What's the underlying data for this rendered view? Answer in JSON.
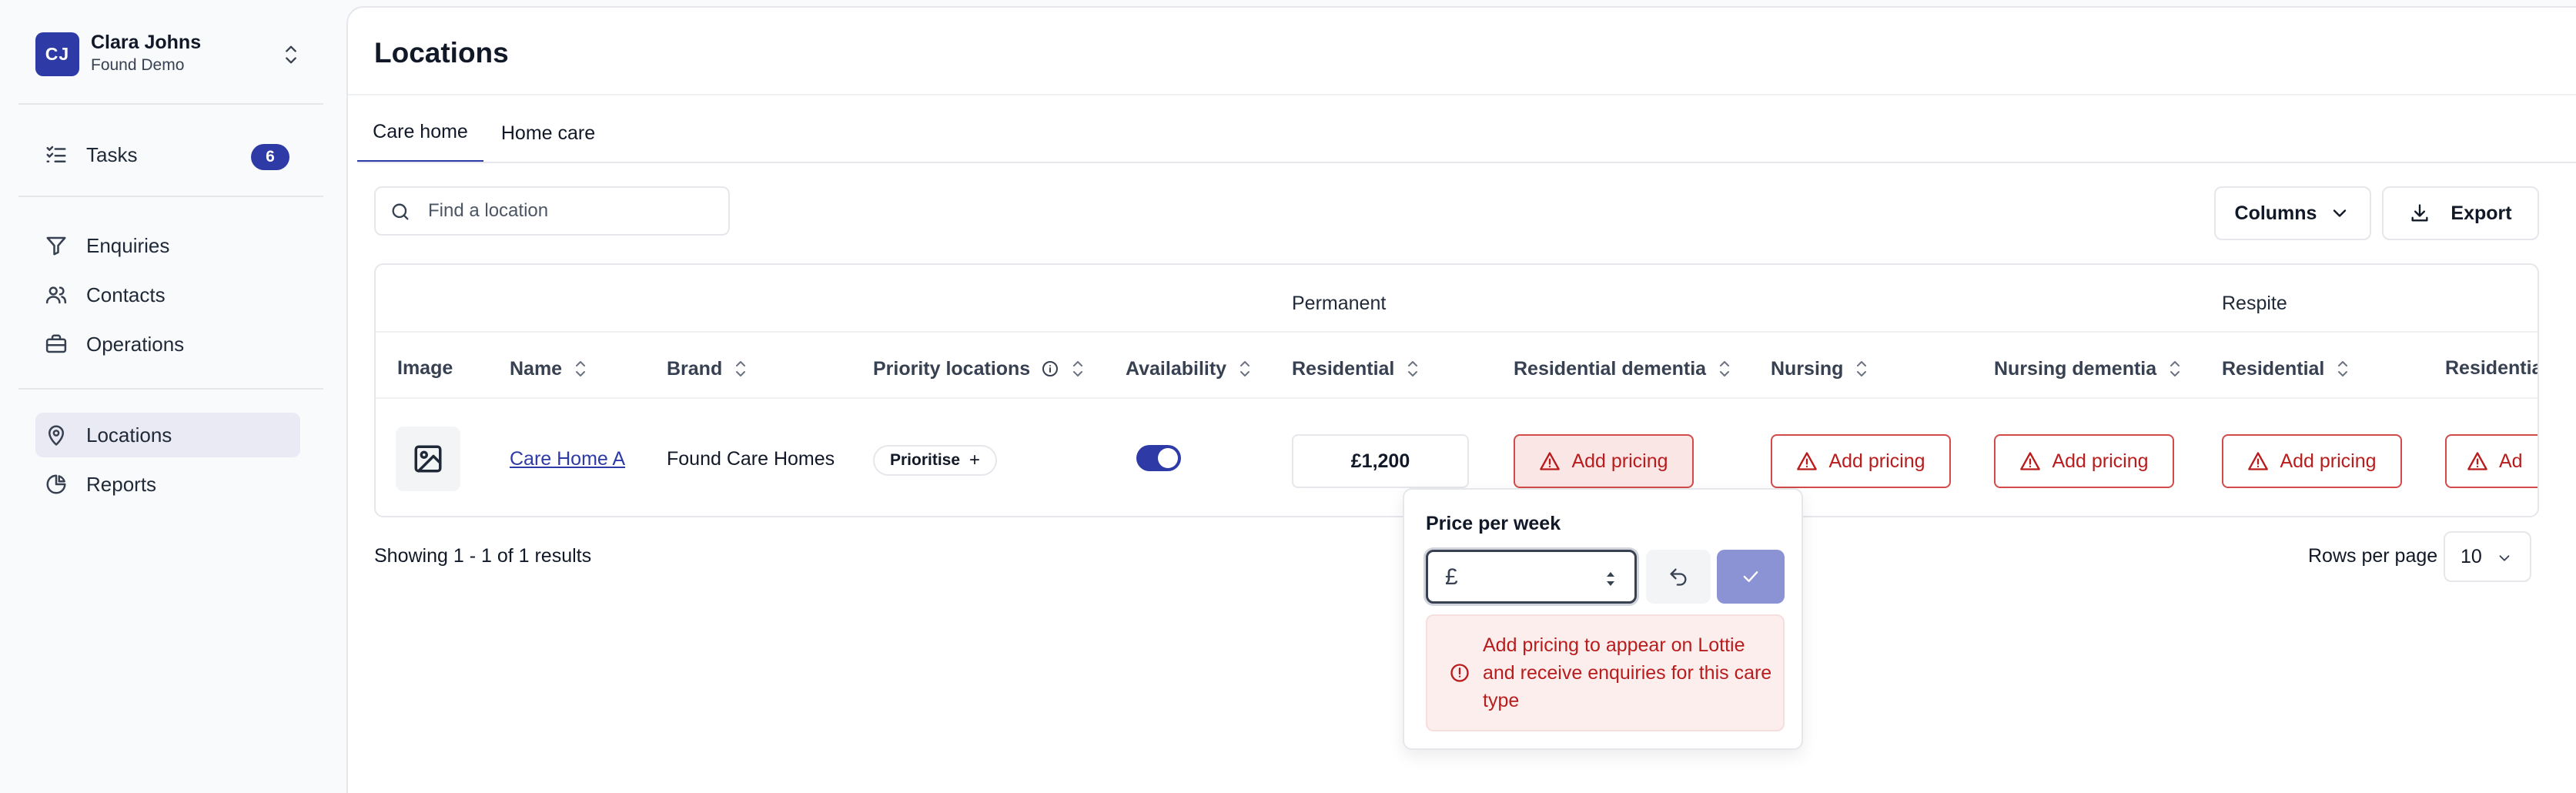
{
  "sidebar": {
    "user": {
      "initials": "CJ",
      "name": "Clara Johns",
      "org": "Found Demo"
    },
    "tasks": {
      "label": "Tasks",
      "count": "6"
    },
    "items": [
      {
        "label": "Enquiries",
        "icon": "filter-icon"
      },
      {
        "label": "Contacts",
        "icon": "users-icon"
      },
      {
        "label": "Operations",
        "icon": "briefcase-icon"
      },
      {
        "label": "Locations",
        "icon": "map-pin-icon",
        "active": true
      },
      {
        "label": "Reports",
        "icon": "pie-chart-icon"
      }
    ]
  },
  "main": {
    "title": "Locations",
    "tabs": [
      {
        "label": "Care home",
        "active": true
      },
      {
        "label": "Home care",
        "active": false
      }
    ],
    "search": {
      "placeholder": "Find a location",
      "value": ""
    },
    "toolbar": {
      "columns_label": "Columns",
      "export_label": "Export"
    },
    "table": {
      "groups": [
        "Permanent",
        "Respite"
      ],
      "columns": [
        "Image",
        "Name",
        "Brand",
        "Priority locations",
        "Availability",
        "Residential",
        "Residential dementia",
        "Nursing",
        "Nursing dementia",
        "Residential",
        "Residentia"
      ],
      "row": {
        "name": "Care Home A",
        "brand": "Found Care Homes",
        "priority_label": "Prioritise",
        "availability_on": true,
        "residential_price": "£1,200",
        "add_pricing_label": "Add pricing",
        "add_pricing_partial": "Ad"
      }
    },
    "showing": "Showing 1 - 1 of 1 results",
    "rows_per_page_label": "Rows per page",
    "rows_per_page_value": "10"
  },
  "popover": {
    "title": "Price per week",
    "currency": "£",
    "value": "",
    "alert": "Add pricing to appear on Lottie and receive enquiries for this care type"
  },
  "colors": {
    "brand": "#2e3aa6",
    "error": "#b91c1c",
    "confirm_disabled": "#8c93d4"
  }
}
